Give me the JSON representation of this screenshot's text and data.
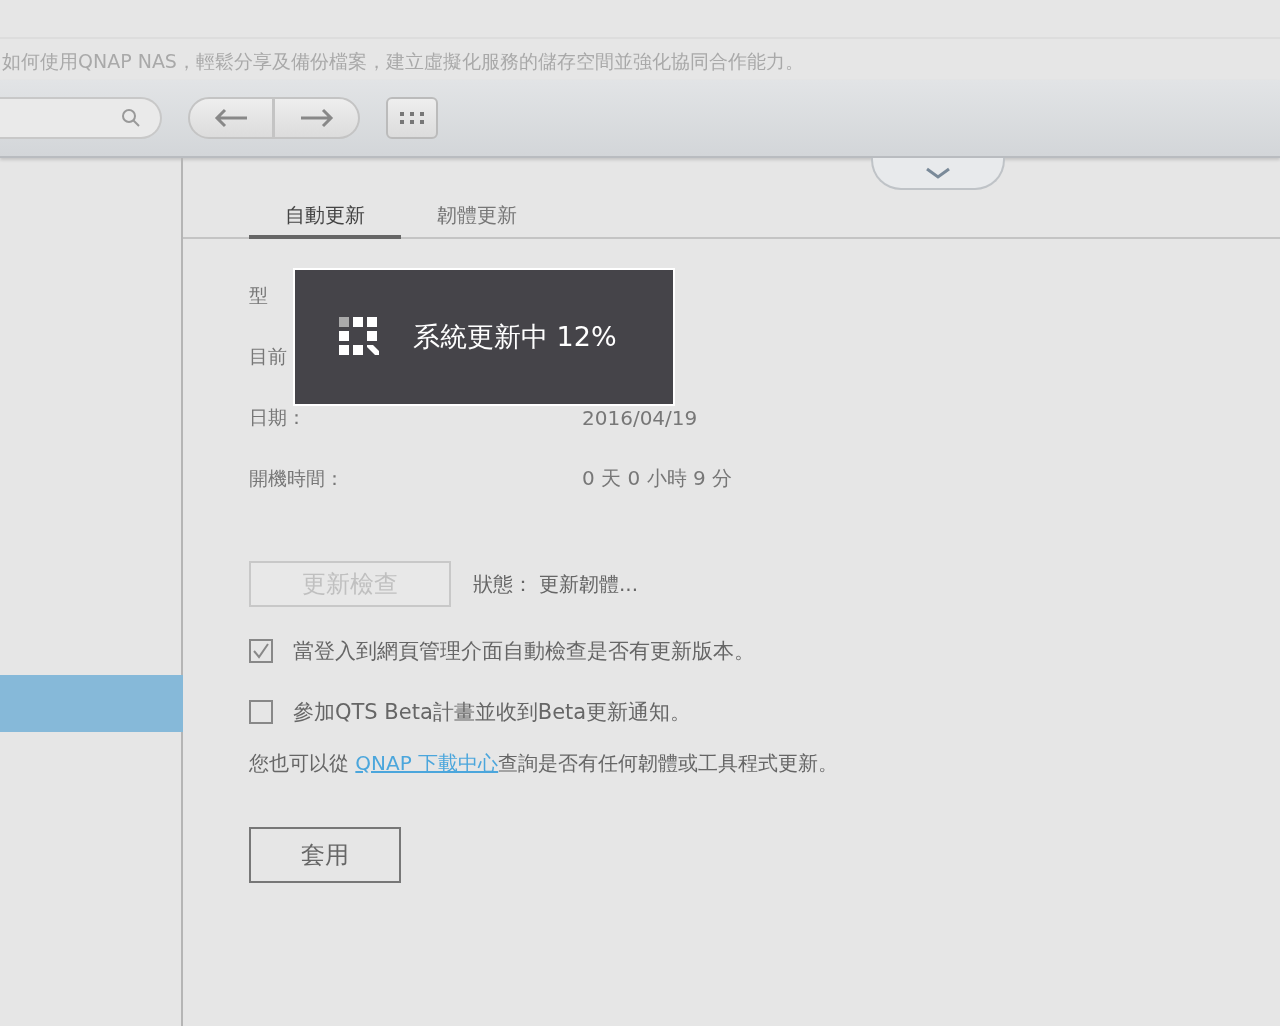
{
  "header": {
    "subtitle": "如何使用QNAP NAS，輕鬆分享及備份檔案，建立虛擬化服務的儲存空間並強化協同合作能力。"
  },
  "sidebar": {
    "items": [
      {
        "selected": true
      }
    ]
  },
  "tabs": [
    {
      "label": "自動更新",
      "selected": true
    },
    {
      "label": "韌體更新",
      "selected": false
    }
  ],
  "info": [
    {
      "label": "型"
    },
    {
      "label": "目前"
    },
    {
      "label": "日期：",
      "value": "2016/04/19"
    },
    {
      "label": "開機時間：",
      "value": "0 天 0 小時 9 分"
    }
  ],
  "check_button": {
    "label": "更新檢查",
    "disabled": true
  },
  "status": {
    "label": "狀態：",
    "value": "更新韌體..."
  },
  "options": [
    {
      "label": "當登入到網頁管理介面自動檢查是否有更新版本。",
      "checked": true
    },
    {
      "label": "參加QTS Beta計畫並收到Beta更新通知。",
      "checked": false
    }
  ],
  "note": {
    "before": "您也可以從 ",
    "link": "QNAP 下載中心",
    "after": "查詢是否有任何韌體或工具程式更新。"
  },
  "apply_button": "套用",
  "progress_dialog": {
    "message": "系統更新中 12%"
  }
}
